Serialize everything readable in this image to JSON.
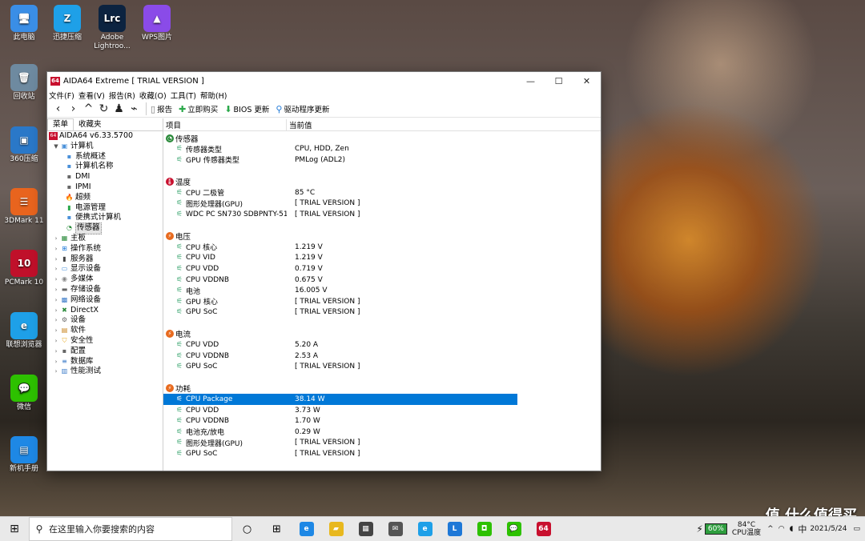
{
  "desktop": {
    "icons": [
      {
        "label": "此电脑",
        "color": "#3a8ee6",
        "glyph": "🖥"
      },
      {
        "label": "迅捷压缩",
        "color": "#1ea0e8",
        "glyph": "Z"
      },
      {
        "label": "Adobe Lightroo...",
        "color": "#0c2340",
        "glyph": "Lrc"
      },
      {
        "label": "WPS图片",
        "color": "#8a4be8",
        "glyph": "▲"
      },
      {
        "label": "回收站",
        "color": "#6e8aa0",
        "glyph": "🗑"
      },
      {
        "label": "360压缩",
        "color": "#2a78c8",
        "glyph": "▣"
      },
      {
        "label": "3DMark 11",
        "color": "#e8641e",
        "glyph": "☰"
      },
      {
        "label": "PCMark 10",
        "color": "#c0102a",
        "glyph": "10"
      },
      {
        "label": "联想浏览器",
        "color": "#1ea0e8",
        "glyph": "e"
      },
      {
        "label": "微信",
        "color": "#2dc100",
        "glyph": "💬"
      },
      {
        "label": "新机手册",
        "color": "#1e88e5",
        "glyph": "▤"
      }
    ],
    "watermark": "值 什么值得买"
  },
  "window": {
    "logo": "64",
    "title": "AIDA64 Extreme  [ TRIAL VERSION ]",
    "controls": {
      "minimize": "—",
      "maximize": "☐",
      "close": "✕"
    },
    "menu": [
      "文件(F)",
      "查看(V)",
      "报告(R)",
      "收藏(O)",
      "工具(T)",
      "帮助(H)"
    ],
    "toolbar": {
      "report": "报告",
      "buy": "立即购买",
      "bios": "BIOS 更新",
      "driver": "驱动程序更新"
    },
    "left_tabs": [
      "菜单",
      "收藏夹"
    ],
    "tree": [
      {
        "label": "AIDA64 v6.33.5700",
        "level": 0,
        "arrow": "",
        "icon": "64",
        "icon_color": "#c8102e"
      },
      {
        "label": "计算机",
        "level": 1,
        "arrow": "▼",
        "icon": "▣",
        "icon_color": "#4a90d9"
      },
      {
        "label": "系统概述",
        "level": 2,
        "arrow": "",
        "icon": "▪",
        "icon_color": "#4a90d9"
      },
      {
        "label": "计算机名称",
        "level": 2,
        "arrow": "",
        "icon": "▪",
        "icon_color": "#4a90d9"
      },
      {
        "label": "DMI",
        "level": 2,
        "arrow": "",
        "icon": "▪",
        "icon_color": "#666"
      },
      {
        "label": "IPMI",
        "level": 2,
        "arrow": "",
        "icon": "▪",
        "icon_color": "#666"
      },
      {
        "label": "超频",
        "level": 2,
        "arrow": "",
        "icon": "🔥",
        "icon_color": "#e86a1e"
      },
      {
        "label": "电源管理",
        "level": 2,
        "arrow": "",
        "icon": "▮",
        "icon_color": "#2aa84a"
      },
      {
        "label": "便携式计算机",
        "level": 2,
        "arrow": "",
        "icon": "▪",
        "icon_color": "#4a90d9"
      },
      {
        "label": "传感器",
        "level": 2,
        "arrow": "",
        "icon": "◔",
        "icon_color": "#2a8a3a",
        "selected": true
      },
      {
        "label": "主板",
        "level": 1,
        "arrow": "›",
        "icon": "▦",
        "icon_color": "#2a8a3a"
      },
      {
        "label": "操作系统",
        "level": 1,
        "arrow": "›",
        "icon": "⊞",
        "icon_color": "#1e78d7"
      },
      {
        "label": "服务器",
        "level": 1,
        "arrow": "›",
        "icon": "▮",
        "icon_color": "#444"
      },
      {
        "label": "显示设备",
        "level": 1,
        "arrow": "›",
        "icon": "▭",
        "icon_color": "#4a90d9"
      },
      {
        "label": "多媒体",
        "level": 1,
        "arrow": "›",
        "icon": "◉",
        "icon_color": "#888"
      },
      {
        "label": "存储设备",
        "level": 1,
        "arrow": "›",
        "icon": "▬",
        "icon_color": "#666"
      },
      {
        "label": "网络设备",
        "level": 1,
        "arrow": "›",
        "icon": "▩",
        "icon_color": "#3a7ac8"
      },
      {
        "label": "DirectX",
        "level": 1,
        "arrow": "›",
        "icon": "✖",
        "icon_color": "#2a8a3a"
      },
      {
        "label": "设备",
        "level": 1,
        "arrow": "›",
        "icon": "⚙",
        "icon_color": "#666"
      },
      {
        "label": "软件",
        "level": 1,
        "arrow": "›",
        "icon": "▤",
        "icon_color": "#c8841e"
      },
      {
        "label": "安全性",
        "level": 1,
        "arrow": "›",
        "icon": "⛉",
        "icon_color": "#e8a81e"
      },
      {
        "label": "配置",
        "level": 1,
        "arrow": "›",
        "icon": "▪",
        "icon_color": "#666"
      },
      {
        "label": "数据库",
        "level": 1,
        "arrow": "›",
        "icon": "≡",
        "icon_color": "#3a7ac8"
      },
      {
        "label": "性能测试",
        "level": 1,
        "arrow": "›",
        "icon": "▥",
        "icon_color": "#3a7ac8"
      }
    ],
    "columns": {
      "item": "项目",
      "value": "当前值"
    },
    "sections": [
      {
        "title": "传感器",
        "color": "#2a8a3a",
        "glyph": "◔",
        "rows": [
          {
            "name": "传感器类型",
            "value": "CPU, HDD, Zen"
          },
          {
            "name": "GPU 传感器类型",
            "value": "PMLog  (ADL2)"
          }
        ]
      },
      {
        "title": "温度",
        "color": "#c8102e",
        "glyph": "🌡",
        "rows": [
          {
            "name": "CPU 二极管",
            "value": "85 °C"
          },
          {
            "name": "图形处理器(GPU)",
            "value": "[ TRIAL VERSION ]"
          },
          {
            "name": "WDC PC SN730 SDBPNTY-51...",
            "value": "[ TRIAL VERSION ]"
          }
        ]
      },
      {
        "title": "电压",
        "color": "#e86a1e",
        "glyph": "⚡",
        "rows": [
          {
            "name": "CPU 核心",
            "value": "1.219 V"
          },
          {
            "name": "CPU VID",
            "value": "1.219 V"
          },
          {
            "name": "CPU VDD",
            "value": "0.719 V"
          },
          {
            "name": "CPU VDDNB",
            "value": "0.675 V"
          },
          {
            "name": "电池",
            "value": "16.005 V"
          },
          {
            "name": "GPU 核心",
            "value": "[ TRIAL VERSION ]"
          },
          {
            "name": "GPU SoC",
            "value": "[ TRIAL VERSION ]"
          }
        ]
      },
      {
        "title": "电流",
        "color": "#e86a1e",
        "glyph": "⚡",
        "rows": [
          {
            "name": "CPU VDD",
            "value": "5.20 A"
          },
          {
            "name": "CPU VDDNB",
            "value": "2.53 A"
          },
          {
            "name": "GPU SoC",
            "value": "[ TRIAL VERSION ]"
          }
        ]
      },
      {
        "title": "功耗",
        "color": "#e86a1e",
        "glyph": "⚡",
        "rows": [
          {
            "name": "CPU Package",
            "value": "38.14 W",
            "highlight": true
          },
          {
            "name": "CPU VDD",
            "value": "3.73 W"
          },
          {
            "name": "CPU VDDNB",
            "value": "1.70 W"
          },
          {
            "name": "电池充/放电",
            "value": "0.29 W"
          },
          {
            "name": "图形处理器(GPU)",
            "value": "[ TRIAL VERSION ]"
          },
          {
            "name": "GPU SoC",
            "value": "[ TRIAL VERSION ]"
          }
        ]
      }
    ]
  },
  "taskbar": {
    "search_placeholder": "在这里输入你要搜索的内容",
    "apps": [
      {
        "name": "task-view",
        "glyph": "○",
        "color": ""
      },
      {
        "name": "widgets",
        "glyph": "⊞",
        "color": ""
      },
      {
        "name": "edge",
        "glyph": "e",
        "color": "#1e88e5"
      },
      {
        "name": "explorer",
        "glyph": "▰",
        "color": "#e8b81e"
      },
      {
        "name": "store",
        "glyph": "▦",
        "color": "#444"
      },
      {
        "name": "mail",
        "glyph": "✉",
        "color": "#555"
      },
      {
        "name": "lenovo-browser",
        "glyph": "e",
        "color": "#1ea0e8"
      },
      {
        "name": "lenovo-app",
        "glyph": "L",
        "color": "#1e78d7"
      },
      {
        "name": "green-app",
        "glyph": "◘",
        "color": "#2dc100"
      },
      {
        "name": "wechat",
        "glyph": "💬",
        "color": "#2dc100"
      },
      {
        "name": "aida64",
        "glyph": "64",
        "color": "#c8102e"
      }
    ],
    "battery": "60%",
    "temp_value": "84°C",
    "temp_label": "CPU温度",
    "ime": "中",
    "date": "2021/5/24"
  }
}
